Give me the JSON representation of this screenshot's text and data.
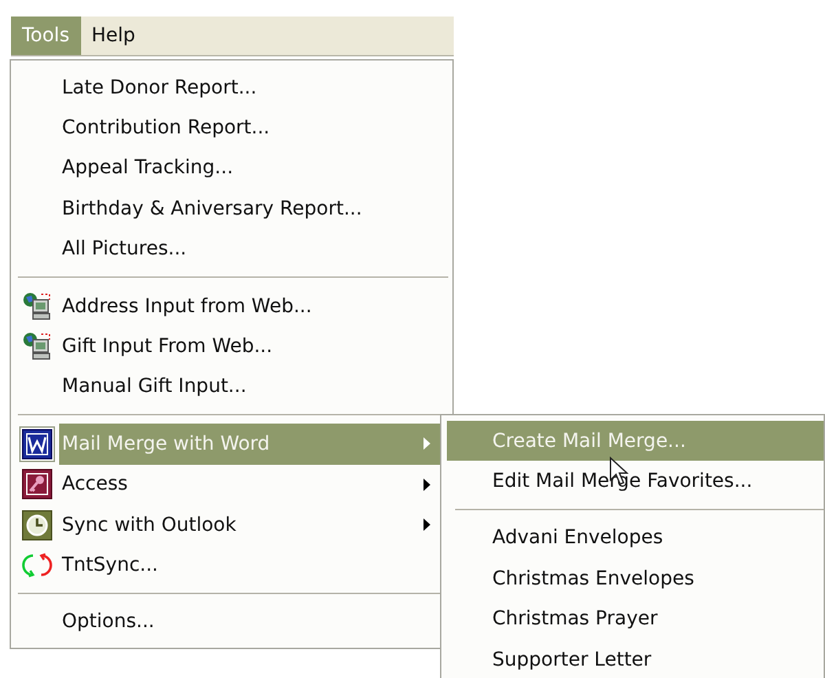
{
  "menu_bar": [
    {
      "label": "Tools",
      "selected": true
    },
    {
      "label": "Help",
      "selected": false
    }
  ],
  "menu": {
    "items": [
      {
        "kind": "item",
        "label": "Late Donor Report...",
        "selected": false
      },
      {
        "kind": "item",
        "label": "Contribution Report...",
        "selected": false
      },
      {
        "kind": "item",
        "label": "Appeal Tracking...",
        "selected": false
      },
      {
        "kind": "item",
        "label": "Birthday & Aniversary Report...",
        "selected": false
      },
      {
        "kind": "item",
        "label": "All Pictures...",
        "selected": false
      },
      {
        "kind": "separator"
      },
      {
        "kind": "item",
        "label": "Address Input from Web...",
        "selected": false
      },
      {
        "kind": "item",
        "label": "Gift Input From Web...",
        "selected": false
      },
      {
        "kind": "item",
        "label": "Manual Gift Input...",
        "selected": false
      },
      {
        "kind": "separator"
      },
      {
        "kind": "item",
        "label": "Mail Merge with Word",
        "has_submenu": true,
        "selected": true
      },
      {
        "kind": "item",
        "label": "Access",
        "has_submenu": true,
        "selected": false
      },
      {
        "kind": "item",
        "label": "Sync with Outlook",
        "has_submenu": true,
        "selected": false
      },
      {
        "kind": "item",
        "label": "TntSync...",
        "selected": false
      },
      {
        "kind": "separator"
      },
      {
        "kind": "item",
        "label": "Options...",
        "selected": false
      }
    ]
  },
  "submenu": {
    "items": [
      {
        "kind": "item",
        "label": "Create Mail Merge...",
        "selected": true
      },
      {
        "kind": "item",
        "label": "Edit Mail Merge Favorites...",
        "selected": false
      },
      {
        "kind": "separator"
      },
      {
        "kind": "item",
        "label": "Advani Envelopes",
        "selected": false
      },
      {
        "kind": "item",
        "label": "Christmas Envelopes",
        "selected": false
      },
      {
        "kind": "item",
        "label": "Christmas Prayer",
        "selected": false
      },
      {
        "kind": "item",
        "label": "Supporter Letter",
        "selected": false
      }
    ]
  }
}
